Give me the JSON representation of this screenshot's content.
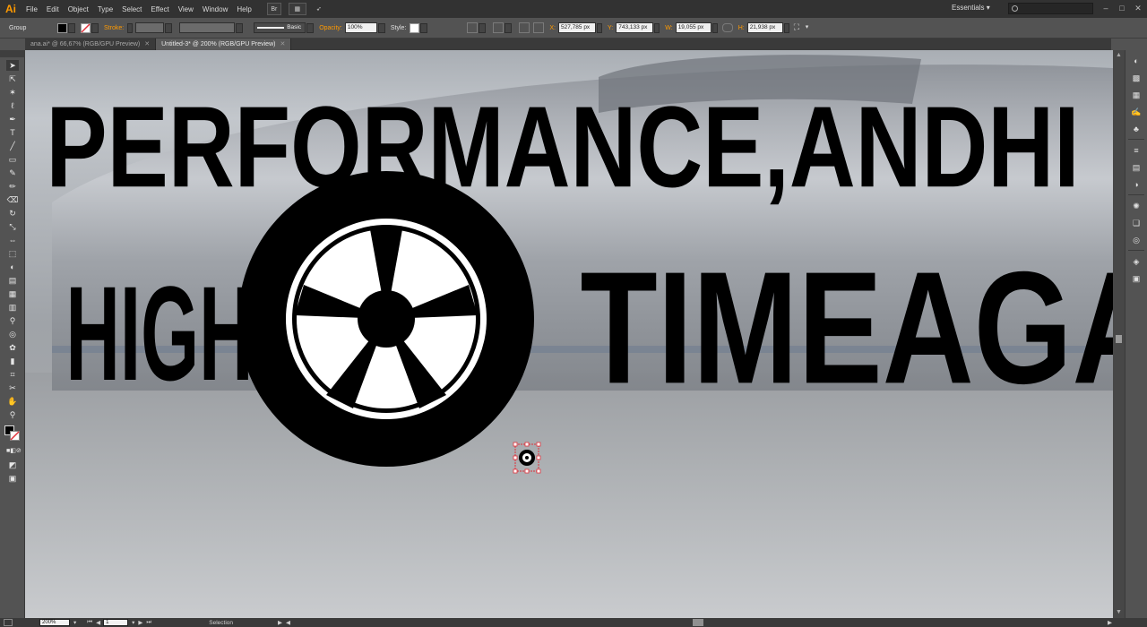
{
  "app": {
    "logo": "Ai",
    "menu": [
      "File",
      "Edit",
      "Object",
      "Type",
      "Select",
      "Effect",
      "View",
      "Window",
      "Help"
    ],
    "bridge_label": "Br",
    "workspace": "Essentials",
    "search_placeholder": ""
  },
  "control_bar": {
    "selection_type": "Group",
    "stroke_label": "Stroke:",
    "brush_label": "Basic",
    "opacity_label": "Opacity:",
    "opacity_value": "100%",
    "style_label": "Style:",
    "x_label": "X:",
    "x_value": "527,785 px",
    "y_label": "Y:",
    "y_value": "743,133 px",
    "w_label": "W:",
    "w_value": "19,055 px",
    "h_label": "H:",
    "h_value": "21,938 px"
  },
  "tabs": [
    {
      "label": "ana.ai* @ 66,67% (RGB/GPU Preview)",
      "active": false
    },
    {
      "label": "Untitled-3* @ 200% (RGB/GPU Preview)",
      "active": true
    }
  ],
  "artwork": {
    "line1": "PERFORMANCE,ANDHI",
    "line2_left": "HIGH",
    "line2_right": "TIMEAGA"
  },
  "status_bar": {
    "zoom": "200%",
    "artboard": "1",
    "tool_name": "Selection"
  },
  "icons": {
    "tools": [
      "selection-tool-icon",
      "direct-selection-tool-icon",
      "magic-wand-icon",
      "lasso-icon",
      "pen-tool-icon",
      "curvature-icon",
      "type-tool-icon",
      "line-tool-icon",
      "rectangle-tool-icon",
      "paintbrush-icon",
      "pencil-icon",
      "eraser-icon",
      "rotate-icon",
      "scale-icon",
      "width-tool-icon",
      "free-transform-icon",
      "shape-builder-icon",
      "perspective-grid-icon",
      "mesh-icon",
      "gradient-icon",
      "eyedropper-icon",
      "blend-icon",
      "symbol-sprayer-icon",
      "graph-icon",
      "artboard-icon",
      "slice-icon",
      "hand-icon",
      "zoom-icon"
    ],
    "dock": [
      "color-icon",
      "color-guide-icon",
      "swatches-icon",
      "brushes-icon",
      "symbols-icon",
      "stroke-icon",
      "gradient-panel-icon",
      "transparency-icon",
      "appearance-icon",
      "graphic-styles-icon",
      "layers-icon",
      "artboards-icon"
    ]
  },
  "colors": {
    "accent": "#ff9a00",
    "fill": "#000000",
    "selection": "#e0303a"
  }
}
